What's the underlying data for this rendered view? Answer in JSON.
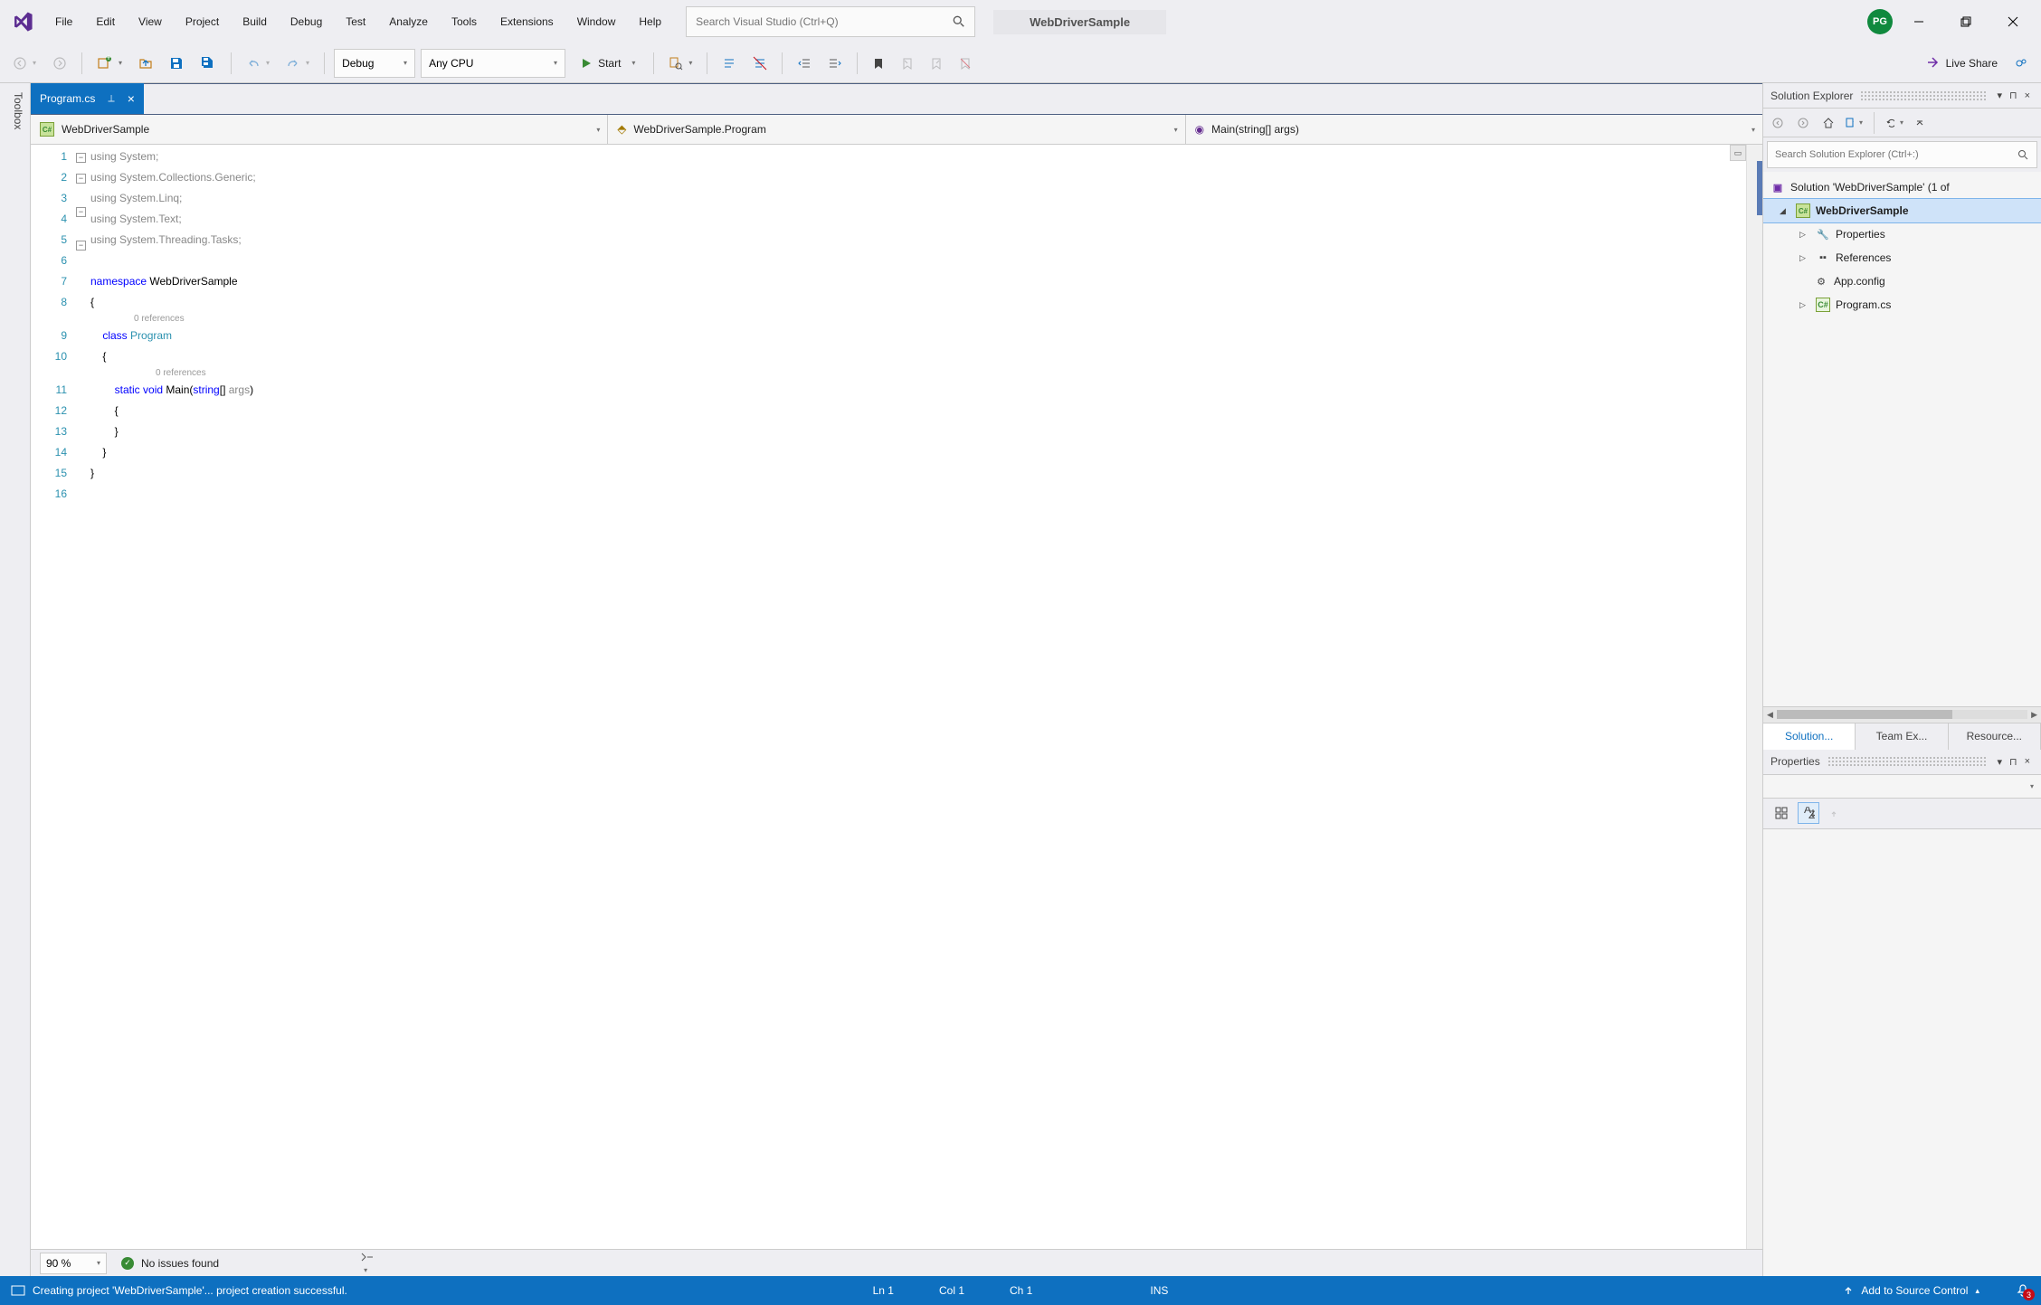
{
  "titlebar": {
    "menus": [
      "File",
      "Edit",
      "View",
      "Project",
      "Build",
      "Debug",
      "Test",
      "Analyze",
      "Tools",
      "Extensions",
      "Window",
      "Help"
    ],
    "search_placeholder": "Search Visual Studio (Ctrl+Q)",
    "app_title": "WebDriverSample",
    "avatar_initials": "PG"
  },
  "toolbar": {
    "config": "Debug",
    "platform": "Any CPU",
    "start": "Start",
    "liveshare": "Live Share"
  },
  "toolbox_label": "Toolbox",
  "tab": {
    "filename": "Program.cs"
  },
  "nav": {
    "project": "WebDriverSample",
    "class": "WebDriverSample.Program",
    "method": "Main(string[] args)"
  },
  "code": {
    "lines": [
      "1",
      "2",
      "3",
      "4",
      "5",
      "6",
      "7",
      "8",
      "9",
      "10",
      "11",
      "12",
      "13",
      "14",
      "15",
      "16"
    ],
    "refs_text": "0 references"
  },
  "editor_status": {
    "zoom": "90 %",
    "issues": "No issues found"
  },
  "solution_explorer": {
    "title": "Solution Explorer",
    "search_placeholder": "Search Solution Explorer (Ctrl+:)",
    "solution_text": "Solution 'WebDriverSample' (1 of",
    "project": "WebDriverSample",
    "properties": "Properties",
    "references": "References",
    "appconfig": "App.config",
    "programcs": "Program.cs",
    "tabs": [
      "Solution...",
      "Team Ex...",
      "Resource..."
    ]
  },
  "properties_panel": {
    "title": "Properties"
  },
  "statusbar": {
    "message": "Creating project 'WebDriverSample'... project creation successful.",
    "ln": "Ln 1",
    "col": "Col 1",
    "ch": "Ch 1",
    "ins": "INS",
    "src_control": "Add to Source Control",
    "notif_count": "3"
  }
}
